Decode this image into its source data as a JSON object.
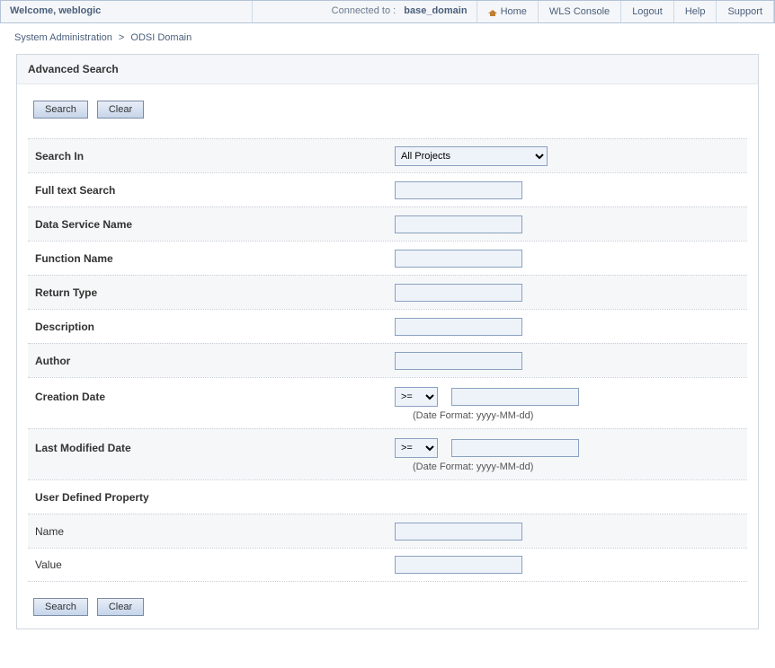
{
  "topbar": {
    "welcome_prefix": "Welcome, ",
    "username": "weblogic",
    "connected_label": "Connected to :",
    "domain": "base_domain",
    "links": {
      "home": "Home",
      "wls": "WLS Console",
      "logout": "Logout",
      "help": "Help",
      "support": "Support"
    }
  },
  "breadcrumb": {
    "parent": "System Administration",
    "sep": ">",
    "current": "ODSI Domain"
  },
  "panel": {
    "title": "Advanced Search",
    "buttons": {
      "search": "Search",
      "clear": "Clear"
    },
    "fields": {
      "search_in_label": "Search In",
      "search_in_value": "All Projects",
      "full_text_label": "Full text Search",
      "full_text_value": "",
      "ds_name_label": "Data Service Name",
      "ds_name_value": "",
      "fn_name_label": "Function Name",
      "fn_name_value": "",
      "return_type_label": "Return Type",
      "return_type_value": "",
      "description_label": "Description",
      "description_value": "",
      "author_label": "Author",
      "author_value": "",
      "creation_date_label": "Creation Date",
      "creation_op": ">=",
      "creation_value": "",
      "date_hint": "(Date Format: yyyy-MM-dd)",
      "modified_date_label": "Last Modified Date",
      "modified_op": ">=",
      "modified_value": "",
      "udp_label": "User Defined Property",
      "udp_name_label": "Name",
      "udp_name_value": "",
      "udp_value_label": "Value",
      "udp_value_value": ""
    }
  }
}
